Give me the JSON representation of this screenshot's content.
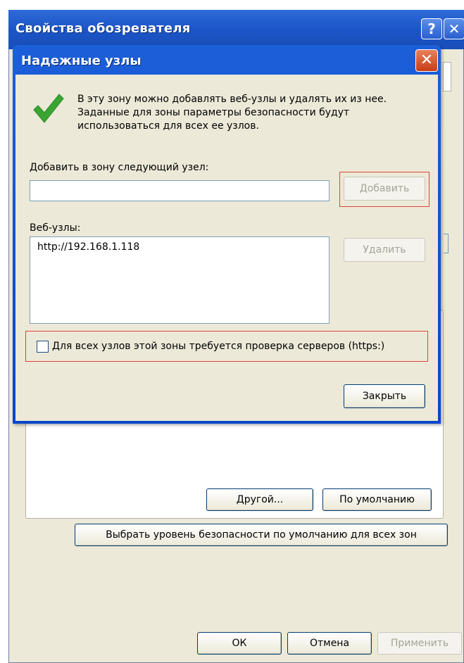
{
  "background_window": {
    "title": "Свойства обозревателя",
    "help_label": "?",
    "close_label": "✕",
    "buttons": {
      "other": "Другой...",
      "default": "По умолчанию",
      "default_all": "Выбрать уровень безопасности по умолчанию для всех зон",
      "ok": "ОК",
      "cancel": "Отмена",
      "apply": "Применить"
    }
  },
  "dialog": {
    "title": "Надежные узлы",
    "close_label": "✕",
    "info_text": "В эту зону можно добавлять веб-узлы и удалять их из нее. Заданные для зоны параметры безопасности будут использоваться для всех ее узлов.",
    "add_label": "Добавить в зону следующий узел:",
    "add_input_value": "",
    "add_button": "Добавить",
    "sites_label": "Веб-узлы:",
    "sites": [
      "http://192.168.1.118"
    ],
    "remove_button": "Удалить",
    "https_checkbox_label": "Для всех узлов этой зоны требуется проверка серверов (https:)",
    "https_checked": false,
    "close_button": "Закрыть"
  },
  "colors": {
    "titlebar": "#1b55c8",
    "dialog_face": "#ece9d8",
    "highlight": "#d9463c",
    "check_green": "#3aa632"
  }
}
